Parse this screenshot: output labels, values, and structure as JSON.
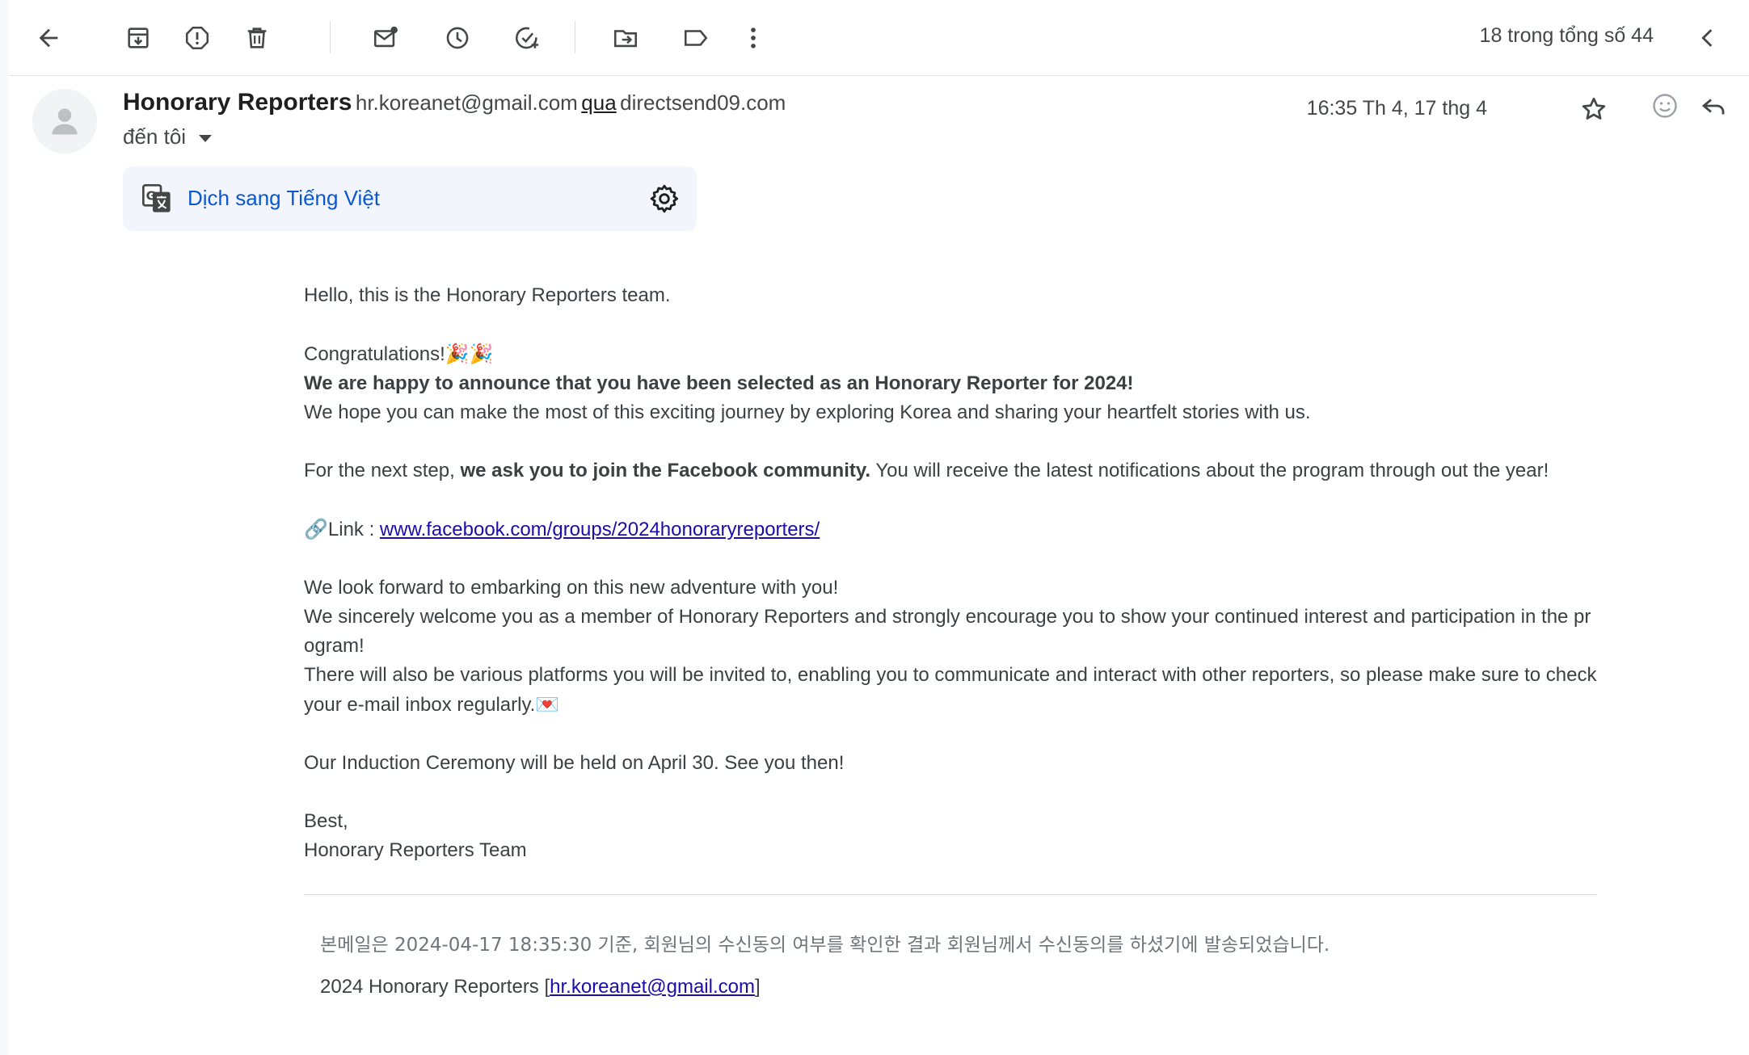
{
  "pager": {
    "text": "18 trong tổng số 44"
  },
  "header": {
    "sender_name": "Honorary Reporters",
    "sender_email": "hr.koreanet@gmail.com",
    "via_label": "qua",
    "via_domain": "directsend09.com",
    "to_label": "đến tôi",
    "date": "16:35 Th 4, 17 thg 4"
  },
  "translate": {
    "label": "Dịch sang Tiếng Việt"
  },
  "body": {
    "greeting": "Hello, this is the Honorary Reporters team.",
    "congrats": "Congratulations!",
    "congrats_emoji": "🎉🎉",
    "announce": "We are happy to announce that you have been selected as an Honorary Reporter for 2024!",
    "hope": "We hope you can make the most of this exciting journey by exploring Korea and sharing your heartfelt stories with us.",
    "next_step_pre": "For the next step, ",
    "next_step_bold": "we ask you to join the Facebook community.",
    "next_step_post": " You will receive the latest notifications about the program through out the year!",
    "link_emoji": "🔗",
    "link_label": "Link : ",
    "link_url": "www.facebook.com/groups/2024honoraryreporters/",
    "forward": "We look forward to embarking on this new adventure with you!",
    "welcome": "We sincerely welcome you as a member of Honorary Reporters and strongly encourage you to show your continued interest and participation in the pr",
    "welcome_cont": "ogram!",
    "platforms": "There will also be various platforms you will be invited to, enabling you to communicate and interact with other reporters, so please make sure to check",
    "platforms_cont": "your e-mail inbox regularly.",
    "mail_emoji": "💌",
    "ceremony": "Our Induction Ceremony will be held on April 30. See you then!",
    "signoff": "Best,",
    "signature": "Honorary Reporters Team"
  },
  "footer": {
    "notice": "본메일은 2024-04-17 18:35:30 기준, 회원님의 수신동의 여부를 확인한 결과 회원님께서 수신동의를 하셨기에 발송되었습니다.",
    "org_prefix": "2024 Honorary Reporters [",
    "org_email": "hr.koreanet@gmail.com",
    "org_suffix": "]"
  }
}
